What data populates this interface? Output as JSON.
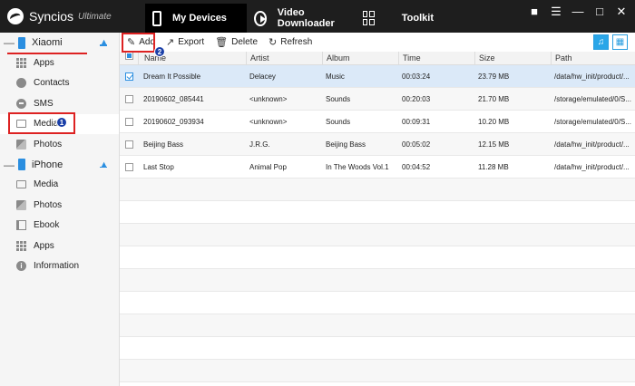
{
  "app": {
    "name": "Syncios",
    "edition": "Ultimate"
  },
  "nav": {
    "tabs": [
      {
        "label": "My Devices",
        "icon": "phone-icon"
      },
      {
        "label": "Video Downloader",
        "icon": "play-icon"
      },
      {
        "label": "Toolkit",
        "icon": "grid-icon"
      }
    ],
    "active": "My Devices"
  },
  "window_controls": [
    "comment-icon",
    "menu-icon",
    "minimize-icon",
    "maximize-icon",
    "close-icon"
  ],
  "sidebar": {
    "devices": [
      {
        "name": "Xiaomi",
        "items": [
          {
            "label": "Apps",
            "icon": "apps-icon"
          },
          {
            "label": "Contacts",
            "icon": "contacts-icon"
          },
          {
            "label": "SMS",
            "icon": "sms-icon"
          },
          {
            "label": "Media",
            "icon": "media-icon"
          },
          {
            "label": "Photos",
            "icon": "photos-icon"
          }
        ]
      },
      {
        "name": "iPhone",
        "items": [
          {
            "label": "Media",
            "icon": "media-icon"
          },
          {
            "label": "Photos",
            "icon": "photos-icon"
          },
          {
            "label": "Ebook",
            "icon": "ebook-icon"
          },
          {
            "label": "Apps",
            "icon": "apps-icon"
          },
          {
            "label": "Information",
            "icon": "info-icon"
          }
        ]
      }
    ],
    "active_item": "Xiaomi / Media"
  },
  "annotations": {
    "badge1": "1",
    "badge2": "2"
  },
  "toolbar": {
    "add": "Add",
    "export": "Export",
    "delete": "Delete",
    "refresh": "Refresh"
  },
  "table": {
    "columns": [
      "Name",
      "Artist",
      "Album",
      "Time",
      "Size",
      "Path"
    ],
    "rows": [
      {
        "name": "Dream It Possible",
        "artist": "Delacey",
        "album": "Music",
        "time": "00:03:24",
        "size": "23.79 MB",
        "path": "/data/hw_init/product/...",
        "checked": true,
        "selected": true
      },
      {
        "name": "20190602_085441",
        "artist": "<unknown>",
        "album": "Sounds",
        "time": "00:20:03",
        "size": "21.70 MB",
        "path": "/storage/emulated/0/S...",
        "checked": false,
        "selected": false
      },
      {
        "name": "20190602_093934",
        "artist": "<unknown>",
        "album": "Sounds",
        "time": "00:09:31",
        "size": "10.20 MB",
        "path": "/storage/emulated/0/S...",
        "checked": false,
        "selected": false
      },
      {
        "name": "Beijing Bass",
        "artist": "J.R.G.",
        "album": "Beijing Bass",
        "time": "00:05:02",
        "size": "12.15 MB",
        "path": "/data/hw_init/product/...",
        "checked": false,
        "selected": false
      },
      {
        "name": "Last Stop",
        "artist": "Animal Pop",
        "album": "In The Woods Vol.1",
        "time": "00:04:52",
        "size": "11.28 MB",
        "path": "/data/hw_init/product/...",
        "checked": false,
        "selected": false
      }
    ]
  },
  "colors": {
    "titlebar": "#1e1e1e",
    "accent": "#2a8ee0",
    "annotation_red": "#dd2222",
    "annotation_badge": "#1a3fa8",
    "selected_row": "#dbe9f8"
  }
}
